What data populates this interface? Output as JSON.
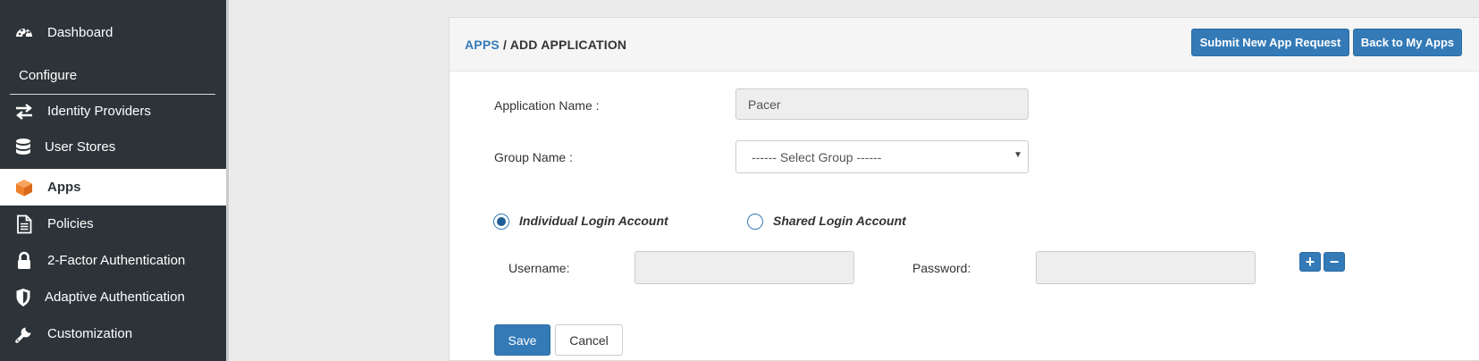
{
  "sidebar": {
    "section_label": "Configure",
    "items": [
      {
        "label": "Dashboard",
        "icon": "dashboard-icon"
      },
      {
        "label": "Identity Providers",
        "icon": "exchange-icon"
      },
      {
        "label": "User Stores",
        "icon": "database-icon"
      },
      {
        "label": "Apps",
        "icon": "cube-icon",
        "active": true
      },
      {
        "label": "Policies",
        "icon": "document-icon"
      },
      {
        "label": "2-Factor Authentication",
        "icon": "lock-icon"
      },
      {
        "label": "Adaptive Authentication",
        "icon": "shield-icon"
      },
      {
        "label": "Customization",
        "icon": "wrench-icon"
      }
    ]
  },
  "header": {
    "breadcrumb_link": "APPS",
    "breadcrumb_sep": " / ",
    "breadcrumb_current": "ADD APPLICATION",
    "submit_button": "Submit New App Request",
    "back_button": "Back to My Apps"
  },
  "form": {
    "app_name_label": "Application Name :",
    "app_name_value": "Pacer",
    "group_label": "Group Name :",
    "group_selected": "------ Select Group ------",
    "radio_individual": "Individual Login Account",
    "radio_shared": "Shared Login Account",
    "selected_account_type": "Individual Login Account",
    "username_label": "Username:",
    "username_value": "",
    "password_label": "Password:",
    "password_value": "",
    "add_symbol": "+",
    "remove_symbol": "−",
    "save_button": "Save",
    "cancel_button": "Cancel"
  },
  "colors": {
    "sidebar_bg": "#2d3439",
    "primary": "#337ab7",
    "active_icon": "#f0812c"
  }
}
